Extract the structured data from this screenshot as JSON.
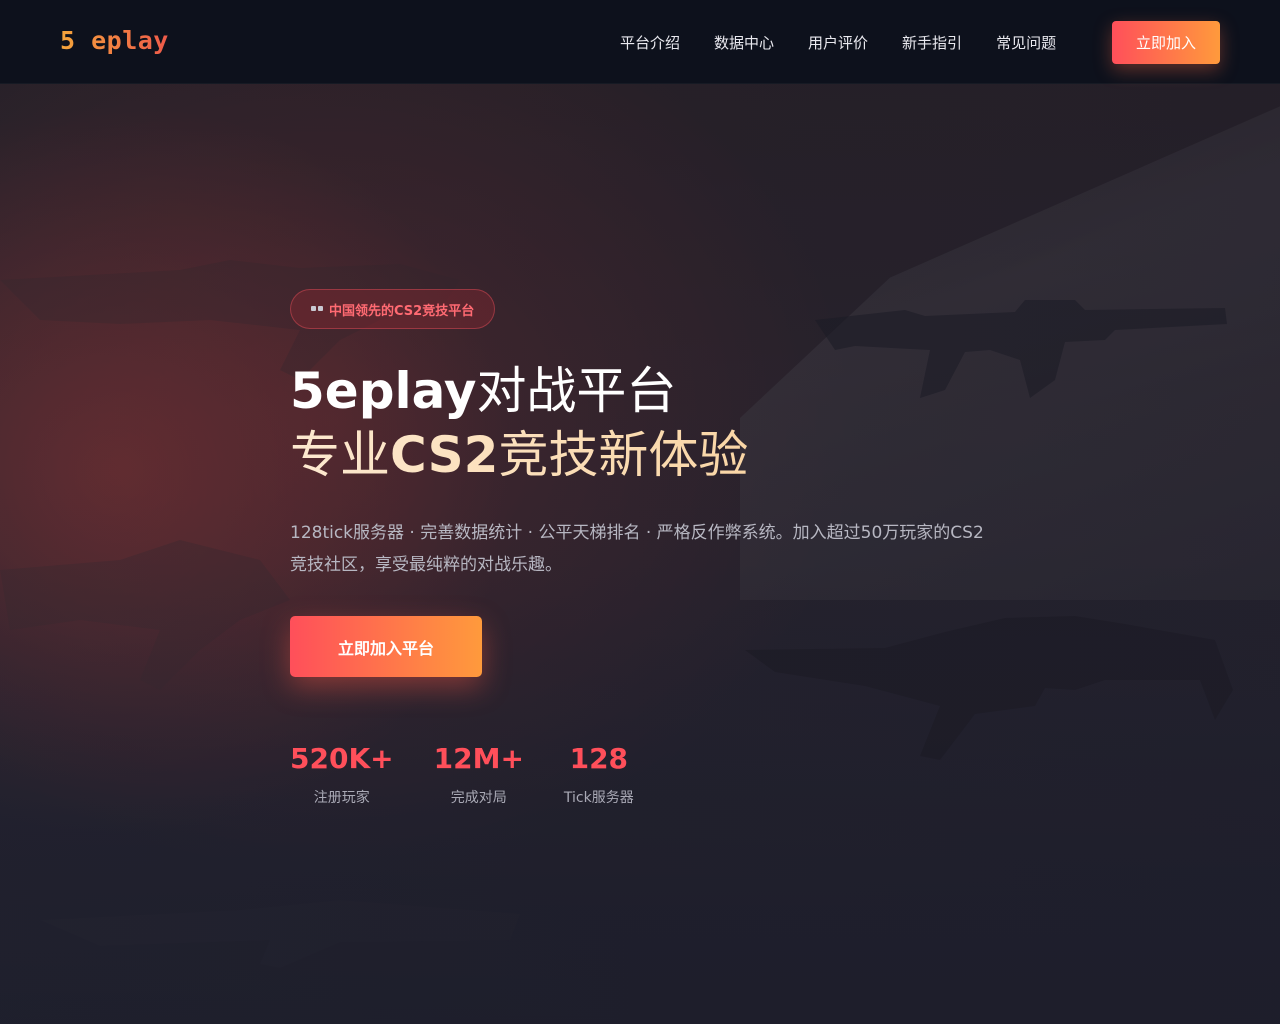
{
  "navbar": {
    "logo": "5 eplay",
    "links": [
      {
        "label": "平台介绍"
      },
      {
        "label": "数据中心"
      },
      {
        "label": "用户评价"
      },
      {
        "label": "新手指引"
      },
      {
        "label": "常见问题"
      }
    ],
    "cta_label": "立即加入"
  },
  "hero": {
    "badge_icon": "gamepad-icon",
    "badge_text": "中国领先的CS2竞技平台",
    "headline_brand": "5eplay",
    "headline_line1_rest": "对战平台",
    "headline_line2_pre": "专业",
    "headline_line2_cs2": "CS2",
    "headline_line2_post": "竞技新体验",
    "description": "128tick服务器 · 完善数据统计 · 公平天梯排名 · 严格反作弊系统。加入超过50万玩家的CS2竞技社区，享受最纯粹的对战乐趣。",
    "cta_label": "立即加入平台"
  },
  "stats": [
    {
      "value": "520K+",
      "label": "注册玩家"
    },
    {
      "value": "12M+",
      "label": "完成对局"
    },
    {
      "value": "128",
      "label": "Tick服务器"
    }
  ],
  "colors": {
    "accent_start": "#ff4f5a",
    "accent_end": "#ff9a3c",
    "navbar_bg": "#0d111c",
    "stat_value": "#ff4f5a",
    "headline_gold": "#f7c98a"
  }
}
